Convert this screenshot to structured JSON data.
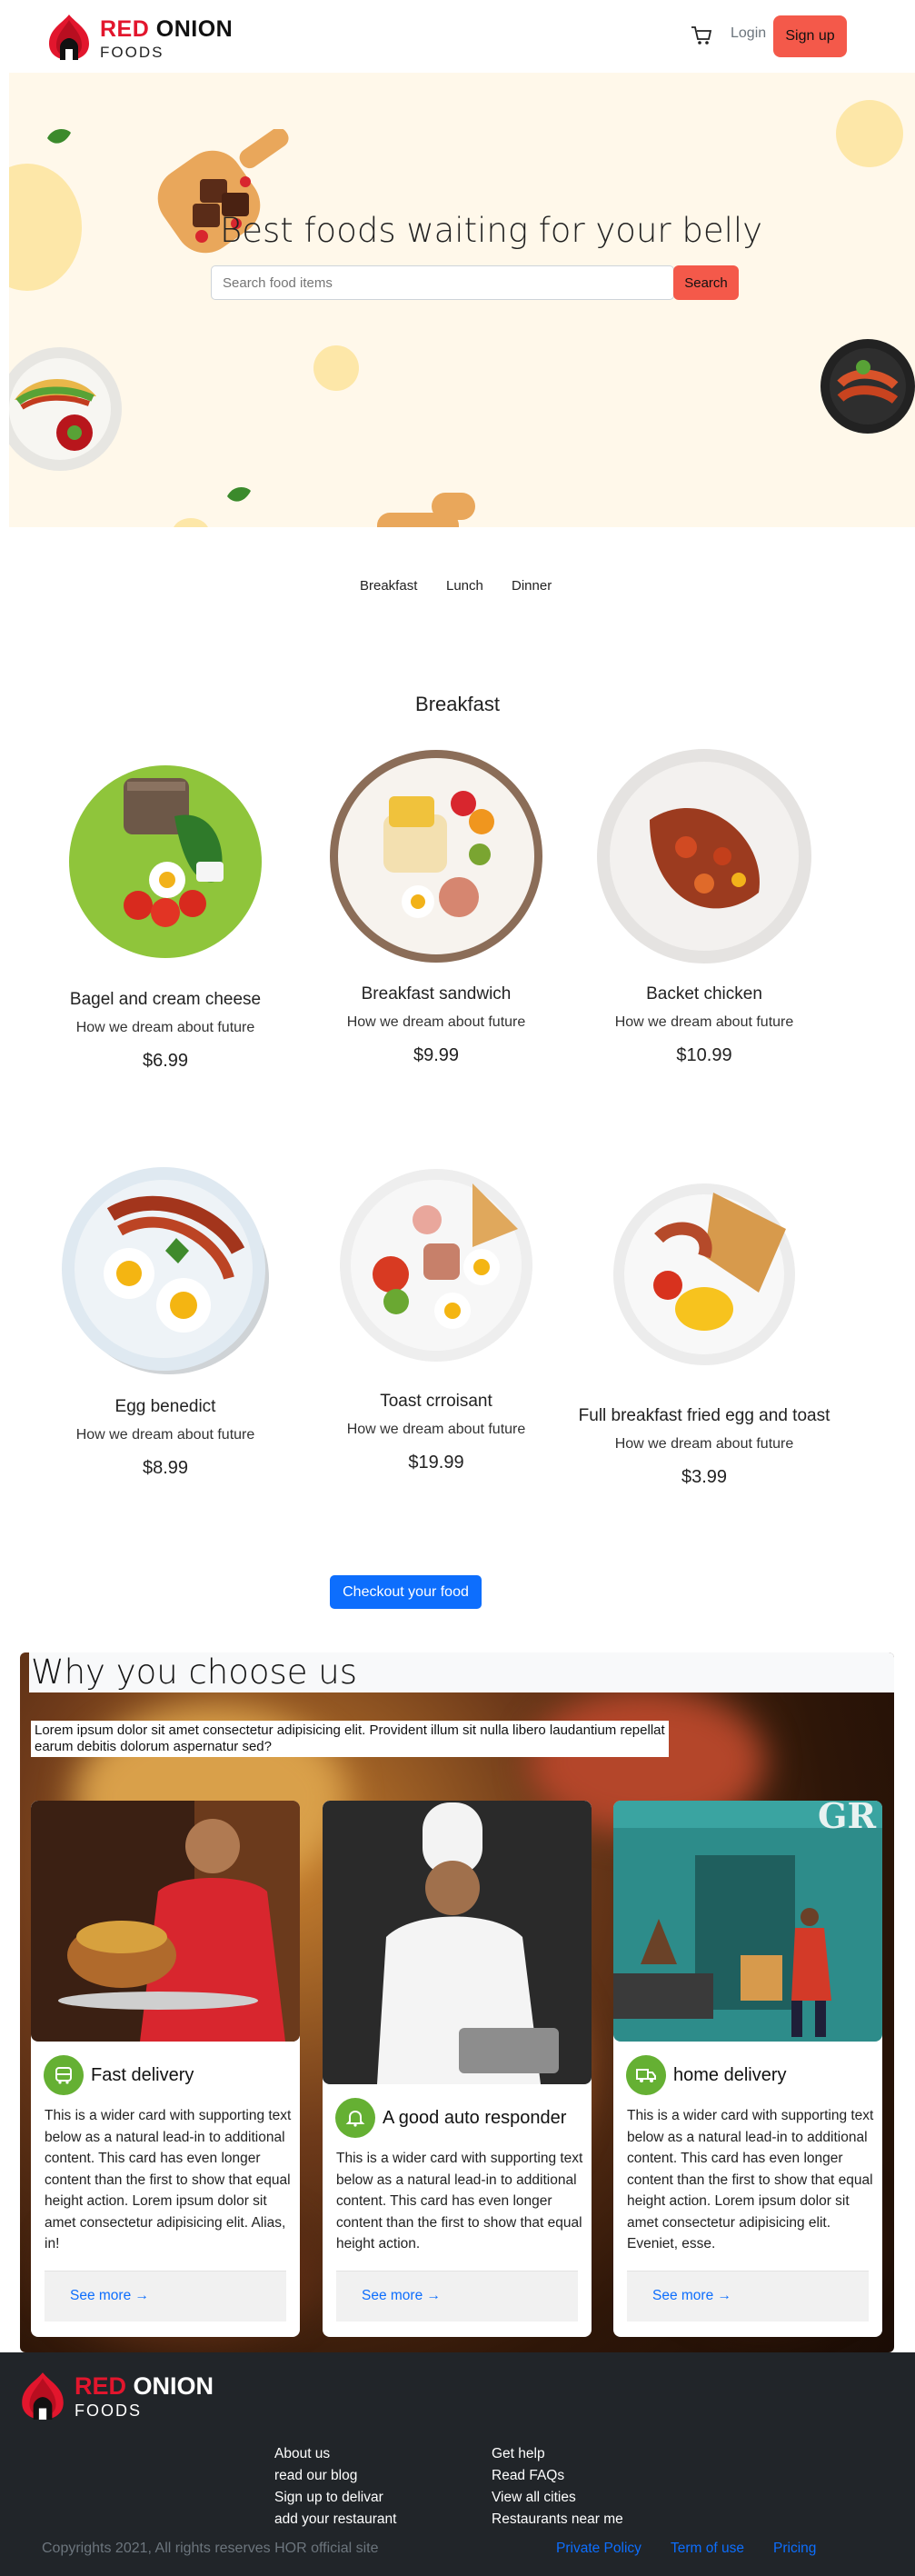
{
  "brand": {
    "name_red": "RED",
    "name_rest": "ONION",
    "subtitle": "FOODS"
  },
  "nav": {
    "login_label": "Login",
    "signup_label": "Sign up",
    "cart_icon": "cart-icon"
  },
  "hero": {
    "title": "Best foods waiting for your belly",
    "search_placeholder": "Search food items",
    "search_button": "Search"
  },
  "tabs": [
    "Breakfast",
    "Lunch",
    "Dinner"
  ],
  "menu": {
    "section_title": "Breakfast",
    "items": [
      {
        "name": "Bagel and cream cheese",
        "desc": "How we dream about future",
        "price": "$6.99"
      },
      {
        "name": "Breakfast sandwich",
        "desc": "How we dream about future",
        "price": "$9.99"
      },
      {
        "name": "Backet chicken",
        "desc": "How we dream about future",
        "price": "$10.99"
      },
      {
        "name": "Egg benedict",
        "desc": "How we dream about future",
        "price": "$8.99"
      },
      {
        "name": "Toast crroisant",
        "desc": "How we dream about future",
        "price": "$19.99"
      },
      {
        "name": "Full breakfast fried egg and toast",
        "desc": "How we dream about future",
        "price": "$3.99"
      }
    ],
    "checkout_label": "Checkout your food"
  },
  "why": {
    "title": "Why you choose us",
    "text": "Lorem ipsum dolor sit amet consectetur adipisicing elit. Provident illum sit nulla libero laudantium repellat earum debitis dolorum aspernatur sed?",
    "cards": [
      {
        "title": "Fast delivery",
        "icon": "bus-icon",
        "body": "This is a wider card with supporting text below as a natural lead-in to additional content. This card has even longer content than the first to show that equal height action. Lorem ipsum dolor sit amet consectetur adipisicing elit. Alias, in!",
        "link": "See more →"
      },
      {
        "title": "A good auto responder",
        "icon": "bell-icon",
        "body": "This is a wider card with supporting text below as a natural lead-in to additional content. This card has even longer content than the first to show that equal height action.",
        "link": "See more →"
      },
      {
        "title": "home delivery",
        "icon": "truck-icon",
        "body": "This is a wider card with supporting text below as a natural lead-in to additional content. This card has even longer content than the first to show that equal height action. Lorem ipsum dolor sit amet consectetur adipisicing elit. Eveniet, esse.",
        "link": "See more →"
      }
    ]
  },
  "footer": {
    "col1": [
      "About us",
      "read our blog",
      "Sign up to delivar",
      "add your restaurant"
    ],
    "col2": [
      "Get help",
      "Read FAQs",
      "View all cities",
      "Restaurants near me"
    ],
    "copyright": "Copyrights 2021, All rights reserves HOR official site",
    "bottom_links": [
      "Private Policy",
      "Term of use",
      "Pricing"
    ]
  },
  "colors": {
    "accent": "#f4594a",
    "brand_red": "#e2162d",
    "primary": "#0d6efd",
    "badge_green": "#65b033",
    "hero_bg": "#fff8ea",
    "footer_bg": "#212529"
  }
}
